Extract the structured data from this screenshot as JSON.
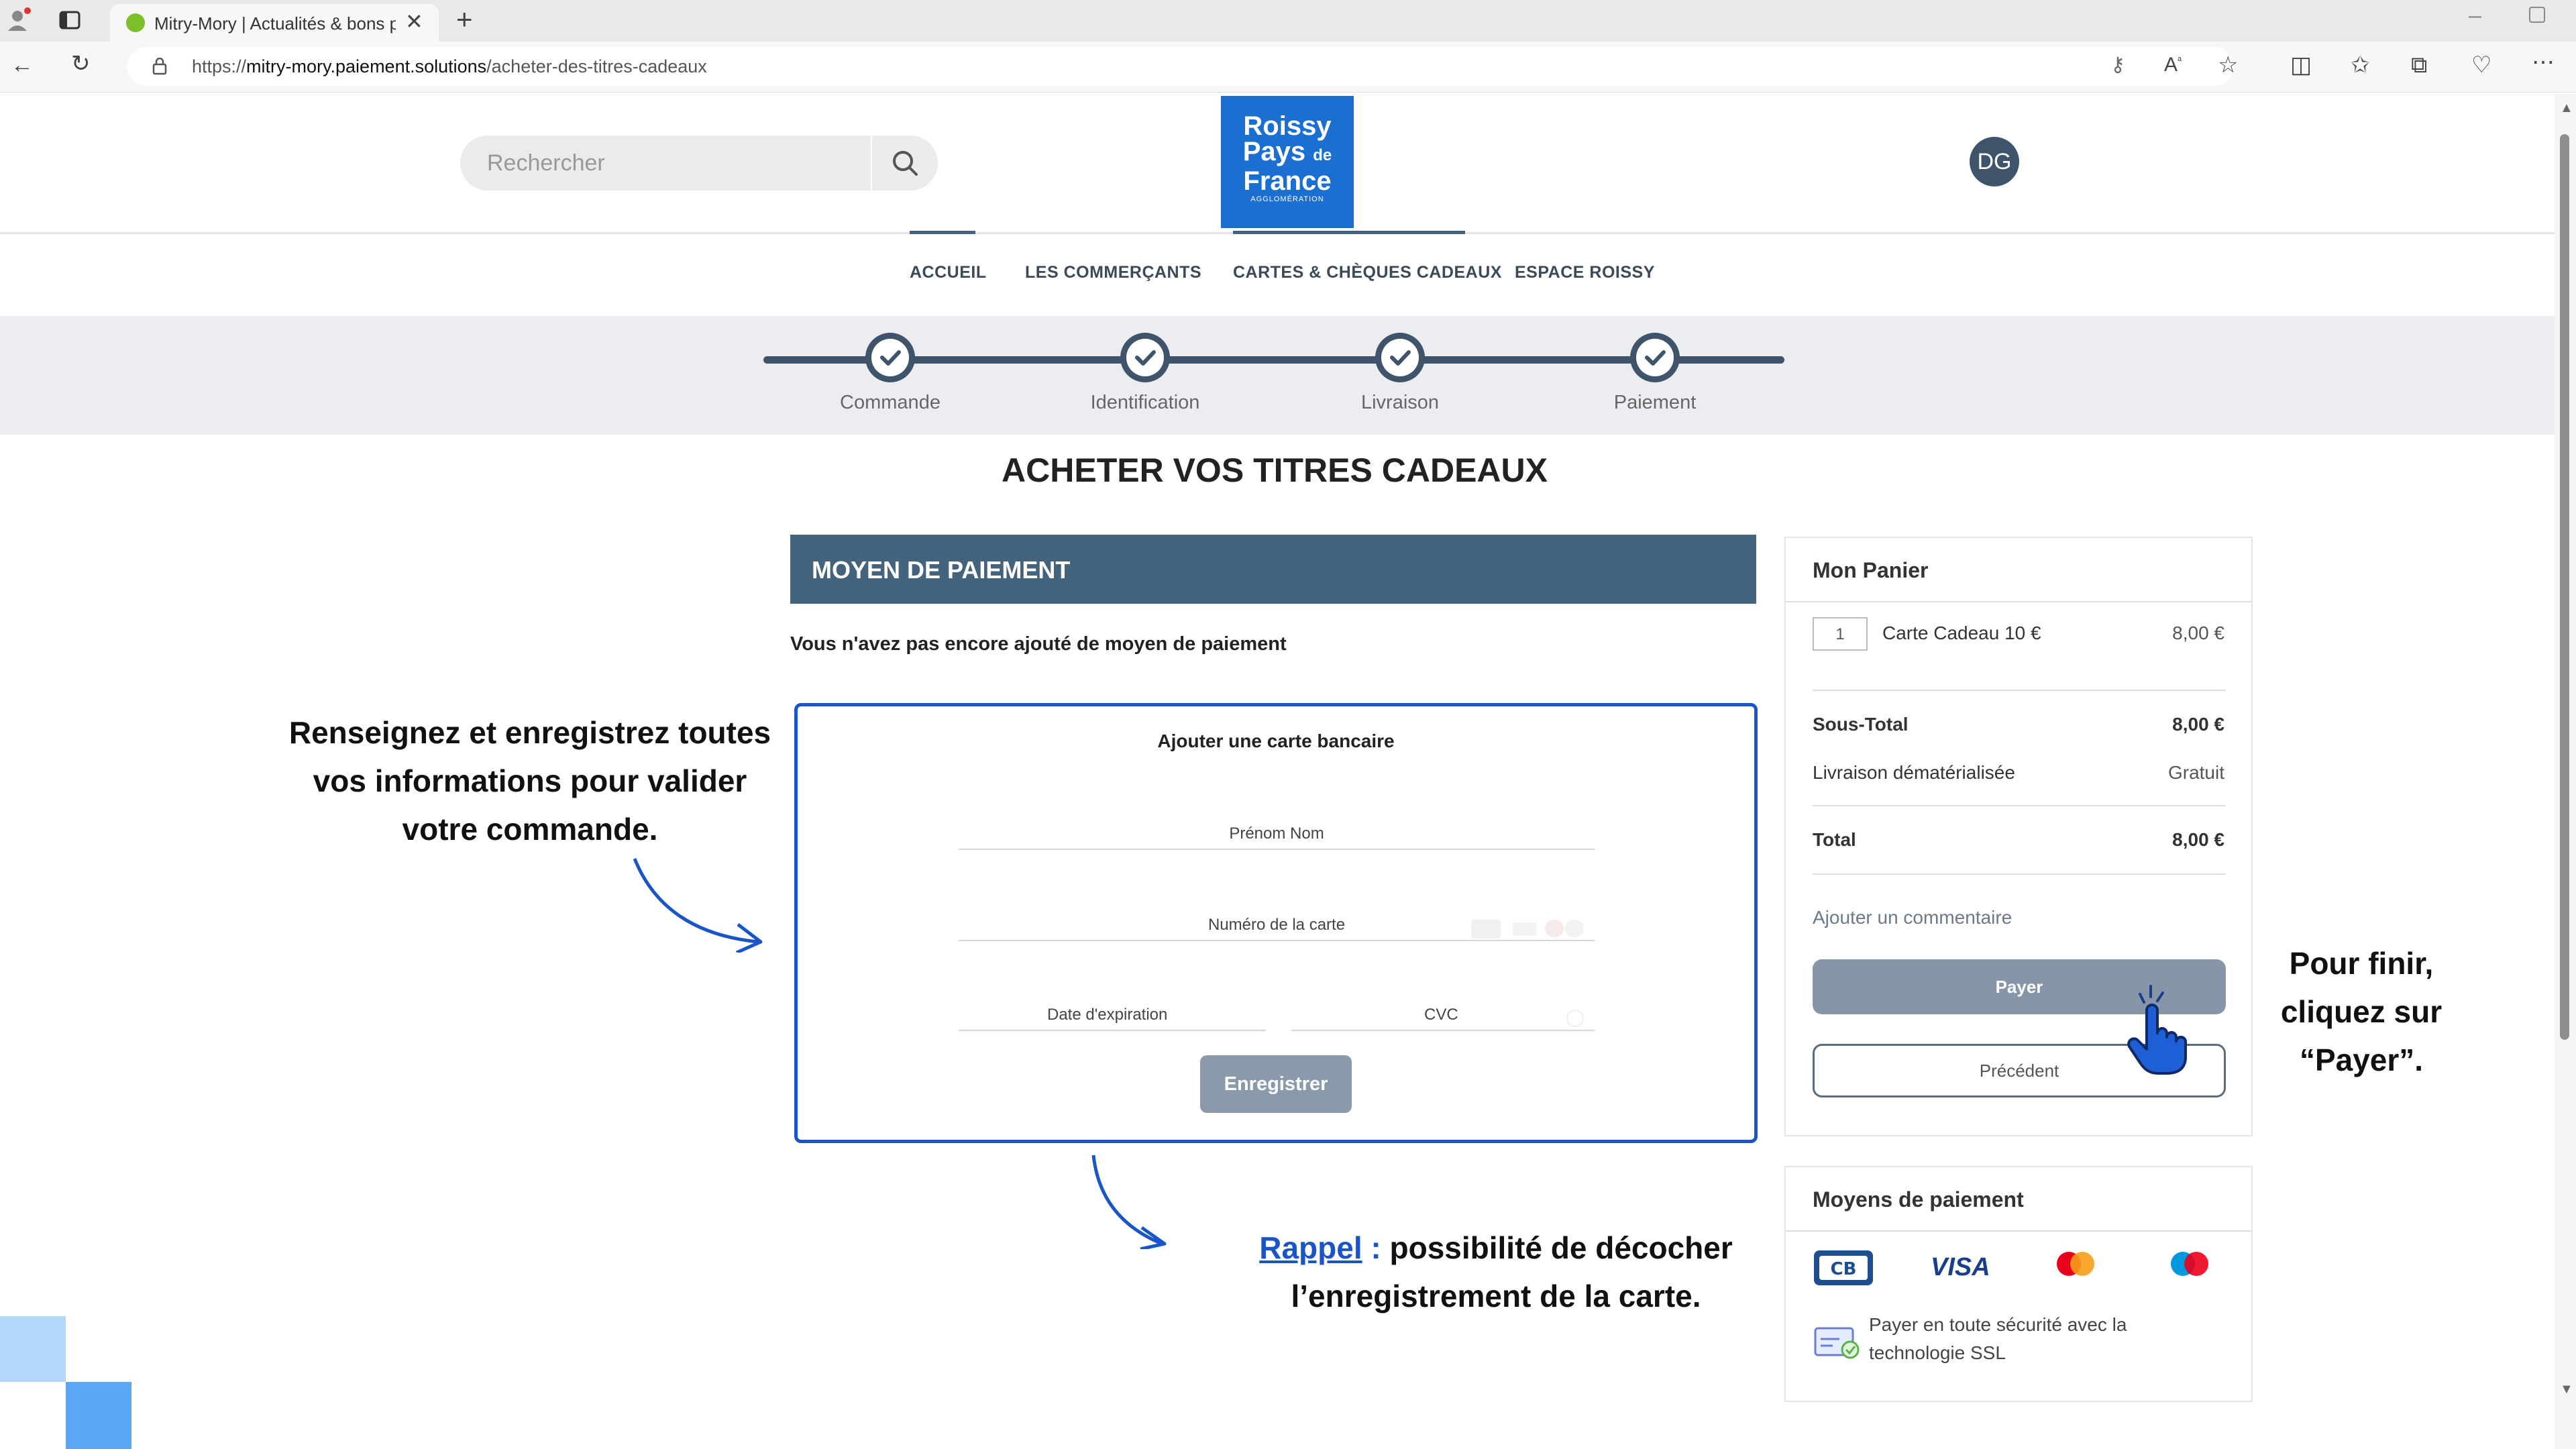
{
  "browser": {
    "tab_title": "Mitry-Mory | Actualités & bons pl",
    "url_prefix": "https://",
    "url_domain": "mitry-mory.paiement.solutions",
    "url_path": "/acheter-des-titres-cadeaux"
  },
  "header": {
    "search_placeholder": "Rechercher",
    "logo_line1": "Roissy",
    "logo_line2a": "Pays",
    "logo_line2b": "de",
    "logo_line3": "France",
    "logo_sub": "AGGLOMÉRATION",
    "avatar_initials": "DG"
  },
  "nav": {
    "items": [
      "ACCUEIL",
      "LES COMMERÇANTS",
      "CARTES & CHÈQUES CADEAUX",
      "ESPACE ROISSY"
    ]
  },
  "stepper": {
    "steps": [
      "Commande",
      "Identification",
      "Livraison",
      "Paiement"
    ]
  },
  "page_title": "ACHETER VOS TITRES CADEAUX",
  "payment": {
    "header": "MOYEN DE PAIEMENT",
    "note": "Vous n'avez pas encore ajouté de moyen de paiement",
    "card_title": "Ajouter une carte bancaire",
    "name_label": "Prénom Nom",
    "number_label": "Numéro de la carte",
    "expiry_label": "Date d'expiration",
    "cvc_label": "CVC",
    "save_button": "Enregistrer"
  },
  "cart": {
    "title": "Mon Panier",
    "item_qty": "1",
    "item_name": "Carte Cadeau 10 €",
    "item_price": "8,00 €",
    "subtotal_label": "Sous-Total",
    "subtotal_value": "8,00 €",
    "delivery_label": "Livraison dématérialisée",
    "delivery_value": "Gratuit",
    "total_label": "Total",
    "total_value": "8,00 €",
    "comment_link": "Ajouter un commentaire",
    "pay_button": "Payer",
    "prev_button": "Précédent"
  },
  "methods": {
    "title": "Moyens de paiement",
    "visa": "VISA",
    "ssl_text_1": "Payer en toute sécurité avec la",
    "ssl_text_2": "technologie SSL"
  },
  "annotations": {
    "left_1": "Renseignez et enregistrez toutes",
    "left_2": "vos informations pour valider",
    "left_3": "votre commande.",
    "right_1": "Pour finir,",
    "right_2": "cliquez sur",
    "right_3": "“Payer”.",
    "bottom_link": "Rappel",
    "bottom_colon": " :",
    "bottom_1": " possibilité de décocher",
    "bottom_2": "l’enregistrement de la carte."
  },
  "colors": {
    "accent": "#1a55c8",
    "header_blue": "#44637c",
    "logo_blue": "#1a6fd0"
  }
}
